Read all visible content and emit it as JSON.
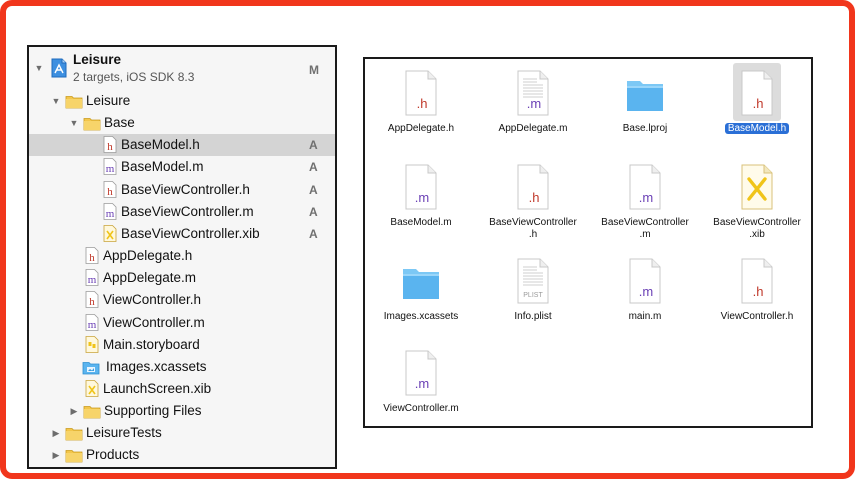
{
  "colors": {
    "frame_border": "#f1361c",
    "header_file": "#c0392b",
    "impl_file": "#6a3fb5",
    "folder_yellow": "#f3c64b",
    "folder_blue": "#5ab4ef",
    "xib_yellow": "#f0c419",
    "selection_blue": "#2a6fd6"
  },
  "navigator": {
    "project": {
      "title": "Leisure",
      "subtitle": "2 targets, iOS SDK 8.3",
      "badge": "M",
      "icon": "xcode-project-icon"
    },
    "items": [
      {
        "label": "Leisure",
        "icon": "folder-icon",
        "disclosure": "open",
        "badge": ""
      },
      {
        "label": "Base",
        "icon": "folder-icon",
        "disclosure": "open",
        "badge": ""
      },
      {
        "label": "BaseModel.h",
        "icon": "header-file-icon",
        "glyph": "h",
        "disclosure": "",
        "badge": "A",
        "selected": true
      },
      {
        "label": "BaseModel.m",
        "icon": "impl-file-icon",
        "glyph": "m",
        "disclosure": "",
        "badge": "A"
      },
      {
        "label": "BaseViewController.h",
        "icon": "header-file-icon",
        "glyph": "h",
        "disclosure": "",
        "badge": "A"
      },
      {
        "label": "BaseViewController.m",
        "icon": "impl-file-icon",
        "glyph": "m",
        "disclosure": "",
        "badge": "A"
      },
      {
        "label": "BaseViewController.xib",
        "icon": "xib-file-icon",
        "glyph": "x",
        "disclosure": "",
        "badge": "A"
      },
      {
        "label": "AppDelegate.h",
        "icon": "header-file-icon",
        "glyph": "h",
        "disclosure": "",
        "badge": ""
      },
      {
        "label": "AppDelegate.m",
        "icon": "impl-file-icon",
        "glyph": "m",
        "disclosure": "",
        "badge": ""
      },
      {
        "label": "ViewController.h",
        "icon": "header-file-icon",
        "glyph": "h",
        "disclosure": "",
        "badge": ""
      },
      {
        "label": "ViewController.m",
        "icon": "impl-file-icon",
        "glyph": "m",
        "disclosure": "",
        "badge": ""
      },
      {
        "label": "Main.storyboard",
        "icon": "storyboard-file-icon",
        "glyph": "",
        "disclosure": "",
        "badge": ""
      },
      {
        "label": "Images.xcassets",
        "icon": "asset-catalog-icon",
        "glyph": "",
        "disclosure": "",
        "badge": ""
      },
      {
        "label": "LaunchScreen.xib",
        "icon": "xib-file-icon",
        "glyph": "x",
        "disclosure": "",
        "badge": ""
      },
      {
        "label": "Supporting Files",
        "icon": "folder-icon",
        "disclosure": "closed",
        "badge": ""
      },
      {
        "label": "LeisureTests",
        "icon": "folder-icon",
        "disclosure": "closed",
        "badge": ""
      },
      {
        "label": "Products",
        "icon": "folder-icon",
        "disclosure": "closed",
        "badge": ""
      }
    ]
  },
  "finder": {
    "files": [
      {
        "lines": [
          "AppDelegate.h"
        ],
        "icon": "header-file-icon",
        "glyph": ".h",
        "lined": false
      },
      {
        "lines": [
          "AppDelegate.m"
        ],
        "icon": "impl-file-icon",
        "glyph": ".m",
        "lined": true
      },
      {
        "lines": [
          "Base.lproj"
        ],
        "icon": "blue-folder-icon",
        "glyph": "",
        "lined": false
      },
      {
        "lines": [
          "BaseModel.h"
        ],
        "icon": "header-file-icon",
        "glyph": ".h",
        "lined": false,
        "selected": true
      },
      {
        "lines": [
          "BaseModel.m"
        ],
        "icon": "impl-file-icon",
        "glyph": ".m",
        "lined": false
      },
      {
        "lines": [
          "BaseViewController",
          ".h"
        ],
        "icon": "header-file-icon",
        "glyph": ".h",
        "lined": false
      },
      {
        "lines": [
          "BaseViewController",
          ".m"
        ],
        "icon": "impl-file-icon",
        "glyph": ".m",
        "lined": false
      },
      {
        "lines": [
          "BaseViewController",
          ".xib"
        ],
        "icon": "xib-file-icon",
        "glyph": "",
        "lined": false
      },
      {
        "lines": [
          "Images.xcassets"
        ],
        "icon": "blue-folder-icon",
        "glyph": "",
        "lined": false
      },
      {
        "lines": [
          "Info.plist"
        ],
        "icon": "plist-file-icon",
        "glyph": "PLIST",
        "lined": true
      },
      {
        "lines": [
          "main.m"
        ],
        "icon": "impl-file-icon",
        "glyph": ".m",
        "lined": false
      },
      {
        "lines": [
          "ViewController.h"
        ],
        "icon": "header-file-icon",
        "glyph": ".h",
        "lined": false
      },
      {
        "lines": [
          "ViewController.m"
        ],
        "icon": "impl-file-icon",
        "glyph": ".m",
        "lined": false
      }
    ]
  }
}
